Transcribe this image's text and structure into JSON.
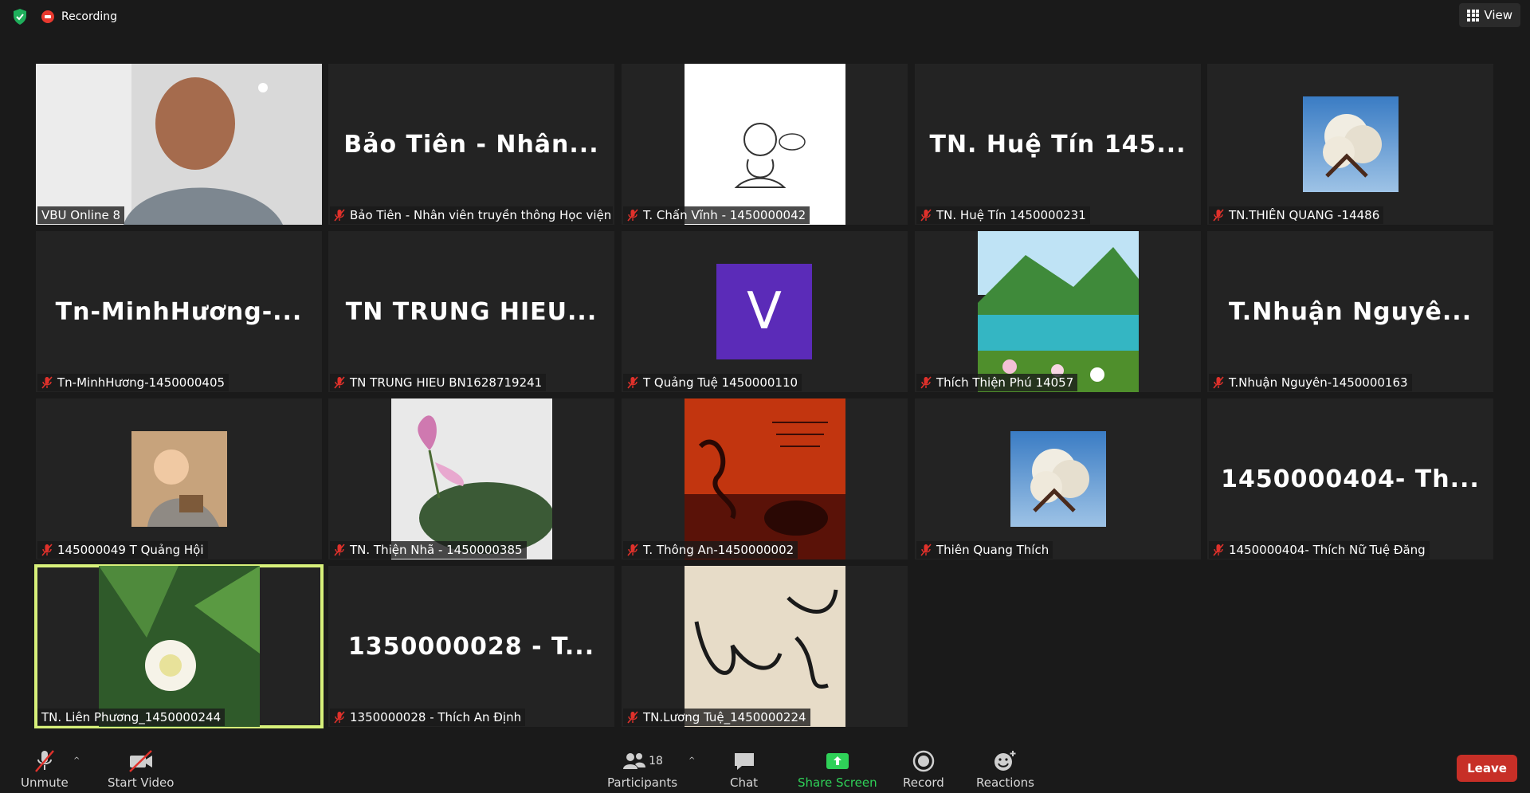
{
  "recording": {
    "label": "Recording"
  },
  "view": {
    "label": "View"
  },
  "tiles": [
    {
      "type": "video",
      "plate": "VBU Online 8",
      "muted": false
    },
    {
      "type": "name",
      "big": "Bảo Tiên - Nhân...",
      "plate": "Bảo Tiên - Nhân viên truyền thông Học viện",
      "muted": true
    },
    {
      "type": "pic",
      "pic": "monk-drawing",
      "plate": "T. Chấn Vĩnh - 1450000042",
      "muted": true
    },
    {
      "type": "name",
      "big": "TN. Huệ Tín 145...",
      "plate": "TN. Huệ Tín 1450000231",
      "muted": true
    },
    {
      "type": "pic",
      "pic": "cotton",
      "plate": "TN.THIÊN QUANG -14486",
      "muted": true
    },
    {
      "type": "name",
      "big": "Tn-MinhHương-...",
      "plate": "Tn-MinhHương-1450000405",
      "muted": true
    },
    {
      "type": "name",
      "big": "TN TRUNG HIEU...",
      "plate": "TN TRUNG HIEU BN1628719241",
      "muted": true
    },
    {
      "type": "avatar",
      "letter": "V",
      "plate": "T Quảng Tuệ 1450000110",
      "muted": true
    },
    {
      "type": "pic",
      "pic": "lake",
      "plate": "Thích Thiện Phú 14057",
      "muted": true
    },
    {
      "type": "name",
      "big": "T.Nhuận Nguyê...",
      "plate": "T.Nhuận Nguyên-1450000163",
      "muted": true
    },
    {
      "type": "pic",
      "pic": "child-monk",
      "plate": "145000049 T Quảng Hội",
      "muted": true
    },
    {
      "type": "pic",
      "pic": "lotus-pink",
      "plate": "TN. Thiện Nhã - 1450000385",
      "muted": true
    },
    {
      "type": "pic",
      "pic": "calligraphy-red",
      "plate": "T. Thông An-1450000002",
      "muted": true
    },
    {
      "type": "pic",
      "pic": "cotton",
      "plate": "Thiên Quang Thích",
      "muted": true
    },
    {
      "type": "name",
      "big": "1450000404- Th...",
      "plate": "1450000404- Thích Nữ Tuệ Đăng",
      "muted": true
    },
    {
      "type": "pic",
      "pic": "lotus-white",
      "plate": "TN. Liên Phương_1450000244",
      "muted": false,
      "active": true
    },
    {
      "type": "name",
      "big": "1350000028 - T...",
      "plate": "1350000028 - Thích An Định",
      "muted": true
    },
    {
      "type": "pic",
      "pic": "calligraphy-beige",
      "plate": "TN.Lương Tuệ_1450000224",
      "muted": true
    }
  ],
  "toolbar": {
    "unmute": "Unmute",
    "start_video": "Start Video",
    "participants": "Participants",
    "participants_count": "18",
    "chat": "Chat",
    "share_screen": "Share Screen",
    "record": "Record",
    "reactions": "Reactions",
    "leave": "Leave"
  },
  "colors": {
    "active_border": "#d7f07a",
    "leave": "#c72f27",
    "share": "#2fd158",
    "avatar_bg": "#5b2bb8"
  }
}
